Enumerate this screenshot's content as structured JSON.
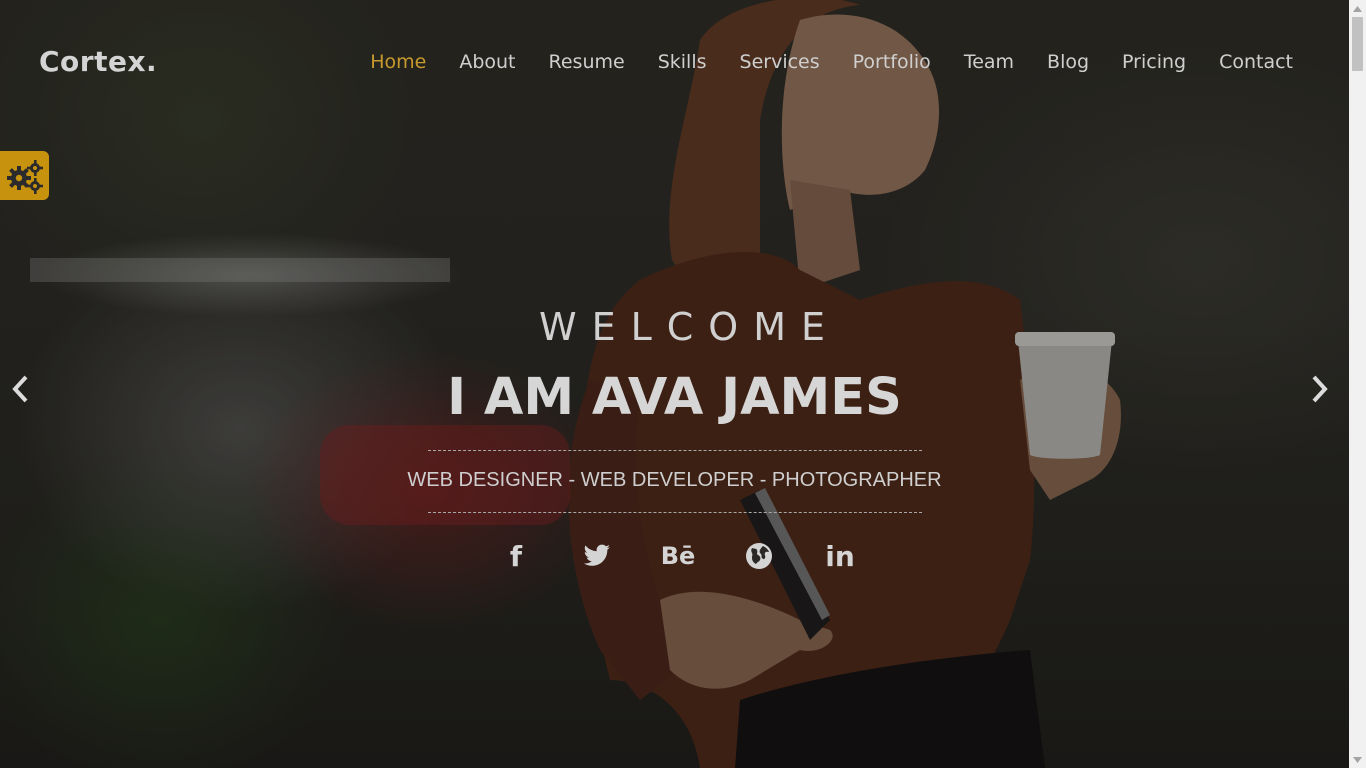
{
  "brand": {
    "logo": "Cortex."
  },
  "nav": {
    "items": [
      {
        "label": "Home",
        "active": true
      },
      {
        "label": "About"
      },
      {
        "label": "Resume"
      },
      {
        "label": "Skills"
      },
      {
        "label": "Services"
      },
      {
        "label": "Portfolio"
      },
      {
        "label": "Team"
      },
      {
        "label": "Blog"
      },
      {
        "label": "Pricing"
      },
      {
        "label": "Contact"
      }
    ]
  },
  "hero": {
    "welcome": "WELCOME",
    "name": "I AM AVA JAMES",
    "tagline": "WEB DESIGNER - WEB DEVELOPER - PHOTOGRAPHER"
  },
  "social": {
    "facebook": "f",
    "behance": "Bē",
    "linkedin": "in",
    "icons": [
      "facebook-icon",
      "twitter-icon",
      "behance-icon",
      "globe-icon",
      "linkedin-icon"
    ]
  },
  "colors": {
    "accent": "#c7930f",
    "active_nav": "#c79a2e",
    "text": "#d0d0d0"
  },
  "settings": {
    "icon": "gears-icon"
  },
  "slider": {
    "prev_icon": "chevron-left-icon",
    "next_icon": "chevron-right-icon"
  }
}
